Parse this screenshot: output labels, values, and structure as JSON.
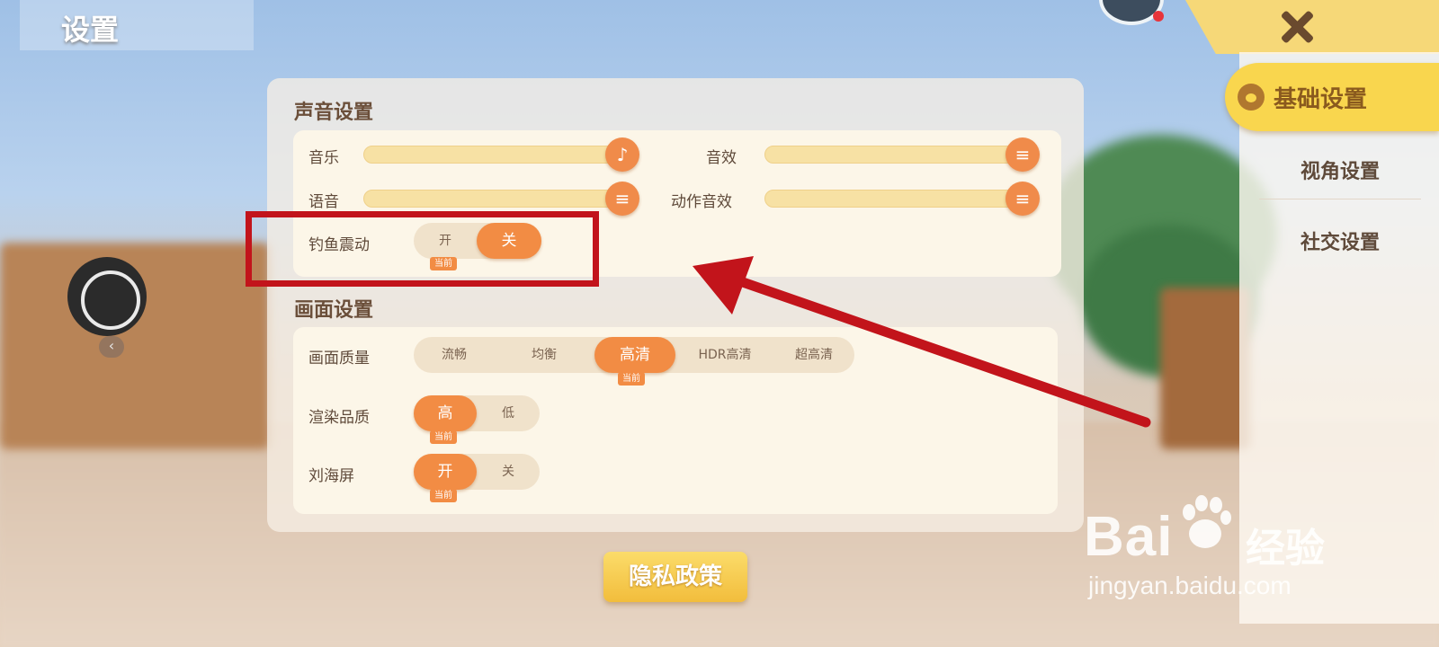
{
  "header": {
    "title": "设置"
  },
  "sidebar": {
    "items": [
      {
        "label": "基础设置",
        "active": true
      },
      {
        "label": "视角设置",
        "active": false
      },
      {
        "label": "社交设置",
        "active": false
      }
    ]
  },
  "sound": {
    "title": "声音设置",
    "music_label": "音乐",
    "effects_label": "音效",
    "voice_label": "语音",
    "action_effects_label": "动作音效",
    "music_level": 1.0,
    "effects_level": 1.0,
    "voice_level": 1.0,
    "action_effects_level": 1.0,
    "fishing_vibration": {
      "label": "钓鱼震动",
      "on": "开",
      "off": "关",
      "selected": "关",
      "current_tag": "当前"
    }
  },
  "graphics": {
    "title": "画面设置",
    "quality": {
      "label": "画面质量",
      "options": [
        "流畅",
        "均衡",
        "高清",
        "HDR高清",
        "超高清"
      ],
      "selected": "高清",
      "current_tag": "当前"
    },
    "render": {
      "label": "渲染品质",
      "options": [
        "高",
        "低"
      ],
      "selected": "高",
      "current_tag": "当前"
    },
    "notch": {
      "label": "刘海屏",
      "options": [
        "开",
        "关"
      ],
      "selected": "开",
      "current_tag": "当前"
    }
  },
  "footer": {
    "privacy_label": "隐私政策"
  },
  "watermark": {
    "brand_left": "Bai",
    "brand_right": "经验",
    "url": "jingyan.baidu.com"
  },
  "colors": {
    "accent": "#f28c44",
    "highlight": "#f9d64e",
    "annotation_red": "#c2141b"
  }
}
